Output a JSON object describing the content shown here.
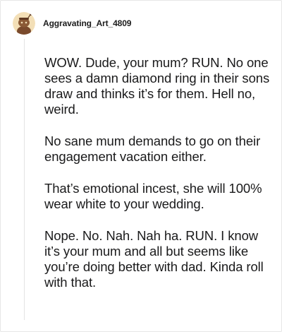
{
  "comment": {
    "author": "Aggravating_Art_4809",
    "avatar_icon": "snoo-avatar-icon",
    "paragraphs": [
      "WOW. Dude, your mum? RUN. No one sees a damn diamond ring in their sons draw and thinks it’s for them. Hell no, weird.",
      "No sane mum demands to go on their engagement vacation either.",
      "That’s emotional incest, she will 100% wear white to your wedding.",
      "Nope. No. Nah. Nah ha. RUN. I know it’s your mum and all but seems like you’re doing better with dad. Kinda roll with that."
    ]
  },
  "colors": {
    "avatar_bg": "#f3dfb7",
    "avatar_figure": "#7a4a2c",
    "text": "#1a1a1b",
    "thread_line": "#e3e3e3"
  }
}
